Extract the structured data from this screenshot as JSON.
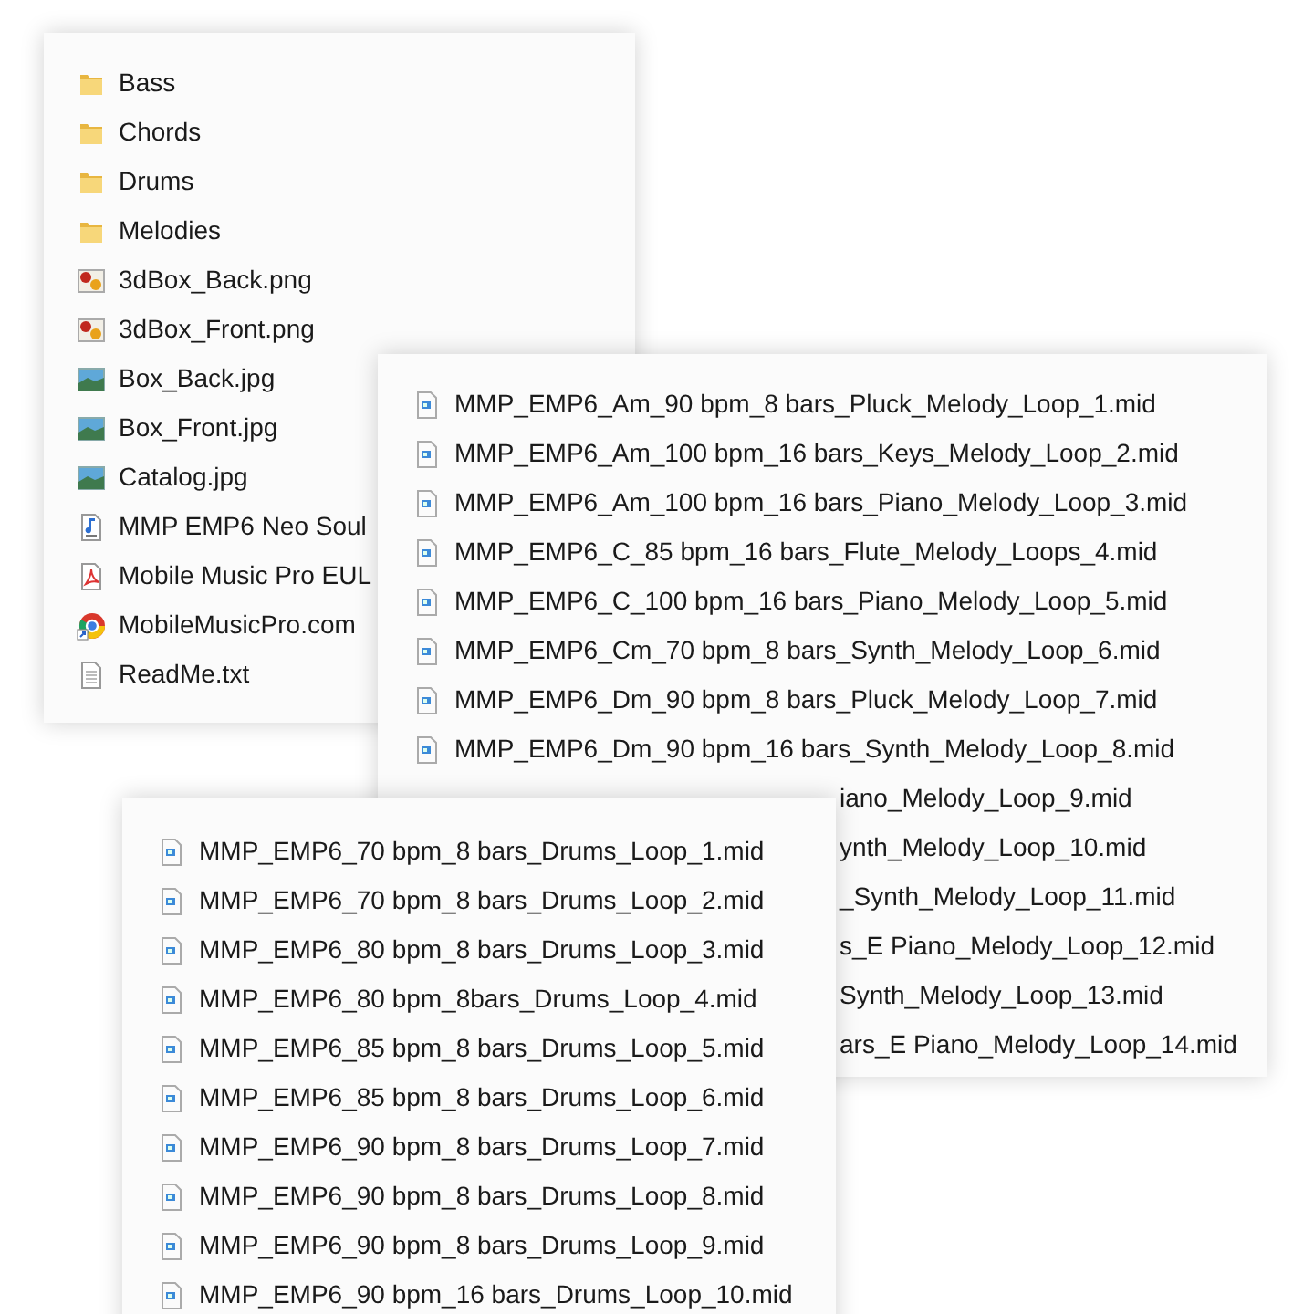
{
  "panels": [
    {
      "items": [
        {
          "kind": "folder",
          "name": "Bass"
        },
        {
          "kind": "folder",
          "name": "Chords"
        },
        {
          "kind": "folder",
          "name": "Drums"
        },
        {
          "kind": "folder",
          "name": "Melodies"
        },
        {
          "kind": "png",
          "name": "3dBox_Back.png"
        },
        {
          "kind": "png",
          "name": "3dBox_Front.png"
        },
        {
          "kind": "jpg",
          "name": "Box_Back.jpg"
        },
        {
          "kind": "jpg",
          "name": "Box_Front.jpg"
        },
        {
          "kind": "jpg",
          "name": "Catalog.jpg"
        },
        {
          "kind": "wav",
          "name": "MMP EMP6 Neo Soul"
        },
        {
          "kind": "pdf",
          "name": "Mobile Music Pro EUL"
        },
        {
          "kind": "web",
          "name": "MobileMusicPro.com"
        },
        {
          "kind": "txt",
          "name": "ReadMe.txt"
        }
      ]
    },
    {
      "items": [
        {
          "kind": "midi",
          "name": "MMP_EMP6_Am_90 bpm_8 bars_Pluck_Melody_Loop_1.mid"
        },
        {
          "kind": "midi",
          "name": "MMP_EMP6_Am_100 bpm_16 bars_Keys_Melody_Loop_2.mid"
        },
        {
          "kind": "midi",
          "name": "MMP_EMP6_Am_100 bpm_16 bars_Piano_Melody_Loop_3.mid"
        },
        {
          "kind": "midi",
          "name": "MMP_EMP6_C_85 bpm_16 bars_Flute_Melody_Loops_4.mid"
        },
        {
          "kind": "midi",
          "name": "MMP_EMP6_C_100 bpm_16 bars_Piano_Melody_Loop_5.mid"
        },
        {
          "kind": "midi",
          "name": "MMP_EMP6_Cm_70 bpm_8 bars_Synth_Melody_Loop_6.mid"
        },
        {
          "kind": "midi",
          "name": "MMP_EMP6_Dm_90 bpm_8 bars_Pluck_Melody_Loop_7.mid"
        },
        {
          "kind": "midi",
          "name": "MMP_EMP6_Dm_90 bpm_16 bars_Synth_Melody_Loop_8.mid"
        },
        {
          "kind": "covered",
          "name": "iano_Melody_Loop_9.mid"
        },
        {
          "kind": "covered",
          "name": "ynth_Melody_Loop_10.mid"
        },
        {
          "kind": "covered",
          "name": "_Synth_Melody_Loop_11.mid"
        },
        {
          "kind": "covered",
          "name": "s_E Piano_Melody_Loop_12.mid"
        },
        {
          "kind": "covered",
          "name": "Synth_Melody_Loop_13.mid"
        },
        {
          "kind": "covered",
          "name": "ars_E Piano_Melody_Loop_14.mid"
        }
      ]
    },
    {
      "items": [
        {
          "kind": "midi",
          "name": "MMP_EMP6_70 bpm_8 bars_Drums_Loop_1.mid"
        },
        {
          "kind": "midi",
          "name": "MMP_EMP6_70 bpm_8 bars_Drums_Loop_2.mid"
        },
        {
          "kind": "midi",
          "name": "MMP_EMP6_80 bpm_8 bars_Drums_Loop_3.mid"
        },
        {
          "kind": "midi",
          "name": "MMP_EMP6_80 bpm_8bars_Drums_Loop_4.mid"
        },
        {
          "kind": "midi",
          "name": "MMP_EMP6_85 bpm_8 bars_Drums_Loop_5.mid"
        },
        {
          "kind": "midi",
          "name": "MMP_EMP6_85 bpm_8 bars_Drums_Loop_6.mid"
        },
        {
          "kind": "midi",
          "name": "MMP_EMP6_90 bpm_8 bars_Drums_Loop_7.mid"
        },
        {
          "kind": "midi",
          "name": "MMP_EMP6_90 bpm_8 bars_Drums_Loop_8.mid"
        },
        {
          "kind": "midi",
          "name": "MMP_EMP6_90 bpm_8 bars_Drums_Loop_9.mid"
        },
        {
          "kind": "midi",
          "name": "MMP_EMP6_90 bpm_16 bars_Drums_Loop_10.mid"
        }
      ]
    }
  ]
}
